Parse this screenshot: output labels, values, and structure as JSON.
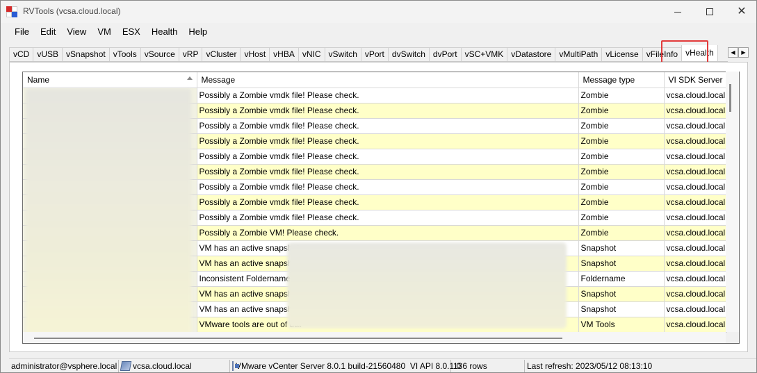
{
  "window": {
    "title": "RVTools (vcsa.cloud.local)"
  },
  "menu": [
    "File",
    "Edit",
    "View",
    "VM",
    "ESX",
    "Health",
    "Help"
  ],
  "tabs": [
    "vCD",
    "vUSB",
    "vSnapshot",
    "vTools",
    "vSource",
    "vRP",
    "vCluster",
    "vHost",
    "vHBA",
    "vNIC",
    "vSwitch",
    "vPort",
    "dvSwitch",
    "dvPort",
    "vSC+VMK",
    "vDatastore",
    "vMultiPath",
    "vLicense",
    "vFileInfo",
    "vHealth"
  ],
  "active_tab": "vHealth",
  "grid": {
    "columns": [
      "Name",
      "Message",
      "Message type",
      "VI SDK Server"
    ],
    "rows": [
      {
        "message": "Possibly a Zombie vmdk file! Please check.",
        "type": "Zombie",
        "server": "vcsa.cloud.local"
      },
      {
        "message": "Possibly a Zombie vmdk file! Please check.",
        "type": "Zombie",
        "server": "vcsa.cloud.local"
      },
      {
        "message": "Possibly a Zombie vmdk file! Please check.",
        "type": "Zombie",
        "server": "vcsa.cloud.local"
      },
      {
        "message": "Possibly a Zombie vmdk file! Please check.",
        "type": "Zombie",
        "server": "vcsa.cloud.local"
      },
      {
        "message": "Possibly a Zombie vmdk file! Please check.",
        "type": "Zombie",
        "server": "vcsa.cloud.local"
      },
      {
        "message": "Possibly a Zombie vmdk file! Please check.",
        "type": "Zombie",
        "server": "vcsa.cloud.local"
      },
      {
        "message": "Possibly a Zombie vmdk file! Please check.",
        "type": "Zombie",
        "server": "vcsa.cloud.local"
      },
      {
        "message": "Possibly a Zombie vmdk file! Please check.",
        "type": "Zombie",
        "server": "vcsa.cloud.local"
      },
      {
        "message": "Possibly a Zombie vmdk file! Please check.",
        "type": "Zombie",
        "server": "vcsa.cloud.local"
      },
      {
        "message": "Possibly a Zombie VM! Please check.",
        "type": "Zombie",
        "server": "vcsa.cloud.local"
      },
      {
        "message": "VM has an active snapshot",
        "type": "Snapshot",
        "server": "vcsa.cloud.local"
      },
      {
        "message": "VM has an active snapshot",
        "type": "Snapshot",
        "server": "vcsa.cloud.local"
      },
      {
        "message": "Inconsistent Foldername! V",
        "type": "Foldername",
        "server": "vcsa.cloud.local"
      },
      {
        "message": "VM has an active snapshot",
        "type": "Snapshot",
        "server": "vcsa.cloud.local"
      },
      {
        "message": "VM has an active snapshot",
        "type": "Snapshot",
        "server": "vcsa.cloud.local"
      },
      {
        "message": "VMware tools are out of dat",
        "type": "VM Tools",
        "server": "vcsa.cloud.local"
      }
    ]
  },
  "status": {
    "user": "administrator@vsphere.local",
    "server": "vcsa.cloud.local",
    "product": "VMware vCenter Server 8.0.1 build-21560480",
    "api": "VI API 8.0.1.0",
    "rows": "136 rows",
    "refresh": "Last refresh: 2023/05/12 08:13:10"
  }
}
